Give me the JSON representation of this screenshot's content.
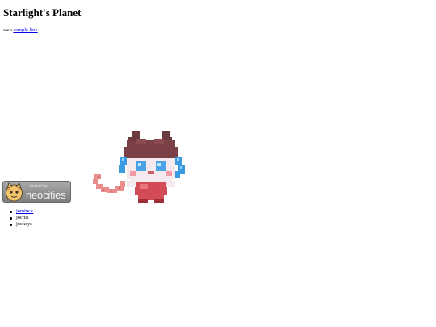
{
  "page": {
    "title": "Starlight's Planet",
    "intro_text": "awo",
    "intro_link": "sample link"
  },
  "badge": {
    "hosted_by": "hosted by",
    "brand": "neocities"
  },
  "links": [
    {
      "label": "jomtuck",
      "is_link": true
    },
    {
      "label": "jochis",
      "is_link": false
    },
    {
      "label": "jockeys",
      "is_link": false
    }
  ]
}
